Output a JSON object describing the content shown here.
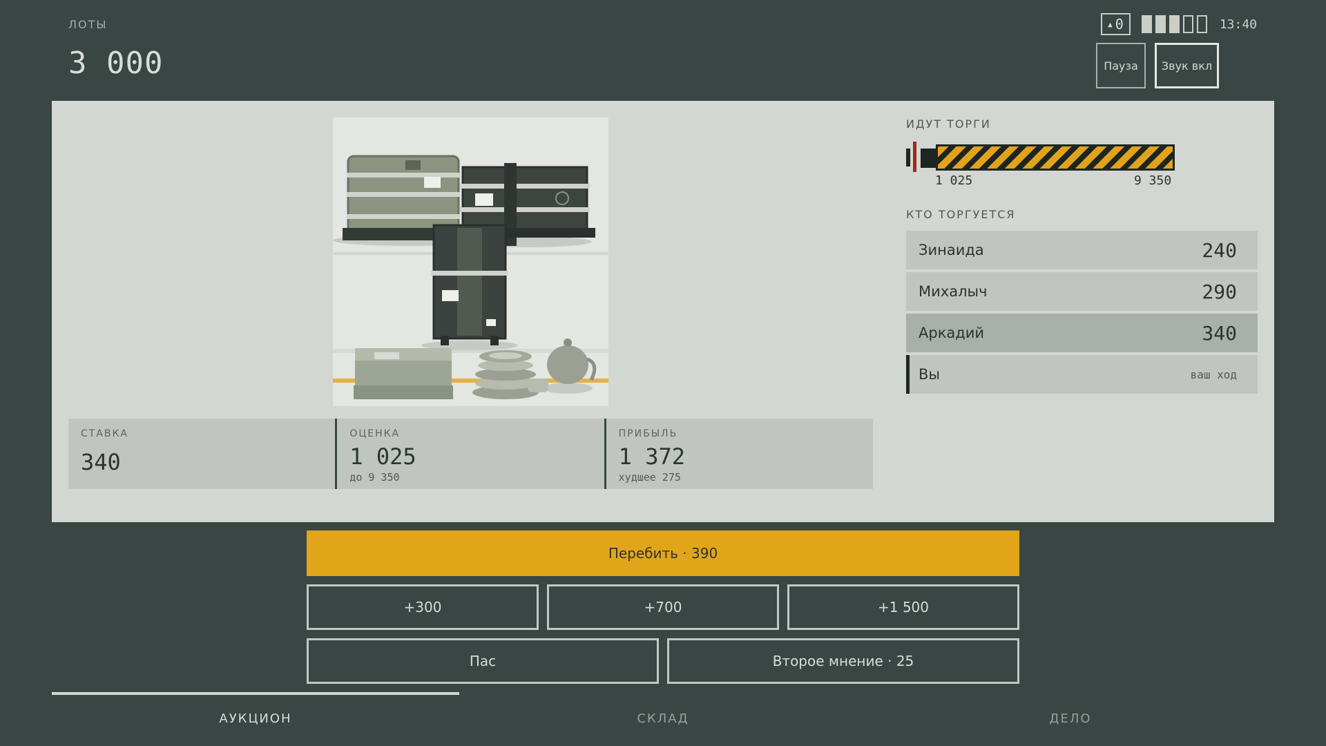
{
  "header": {
    "lots_label": "ЛОТЫ",
    "lots_value": "3 000",
    "counter_icon": "triangle-up-icon",
    "counter_value": "0",
    "battery_segments_filled": 3,
    "battery_segments_total": 5,
    "clock": "13:40",
    "pause_label": "Пауза",
    "sound_label": "Звук вкл"
  },
  "stats": {
    "bid_label": "СТАВКА",
    "bid_value": "340",
    "estimate_label": "ОЦЕНКА",
    "estimate_value": "1 025",
    "estimate_sub": "до 9 350",
    "profit_label": "ПРИБЫЛЬ",
    "profit_value": "1 372",
    "profit_sub": "худшее 275"
  },
  "bidding": {
    "status_label": "ИДУТ ТОРГИ",
    "range_min": "1 025",
    "range_max": "9 350",
    "bidders_label": "КТО ТОРГУЕТСЯ",
    "bidders": [
      {
        "name": "Зинаида",
        "amount": "240"
      },
      {
        "name": "Михалыч",
        "amount": "290"
      },
      {
        "name": "Аркадий",
        "amount": "340"
      },
      {
        "name": "Вы",
        "note": "ваш ход"
      }
    ]
  },
  "actions": {
    "outbid_label": "Перебить · 390",
    "plus_300": "+300",
    "plus_700": "+700",
    "plus_1500": "+1 500",
    "pass_label": "Пас",
    "second_opinion_label": "Второе мнение · 25"
  },
  "tabs": [
    "АУКЦИОН",
    "СКЛАД",
    "ДЕЛО"
  ],
  "colors": {
    "background": "#394643",
    "panel": "#d2d7d2",
    "accent": "#e2a51a",
    "marker": "#a02a1c"
  }
}
